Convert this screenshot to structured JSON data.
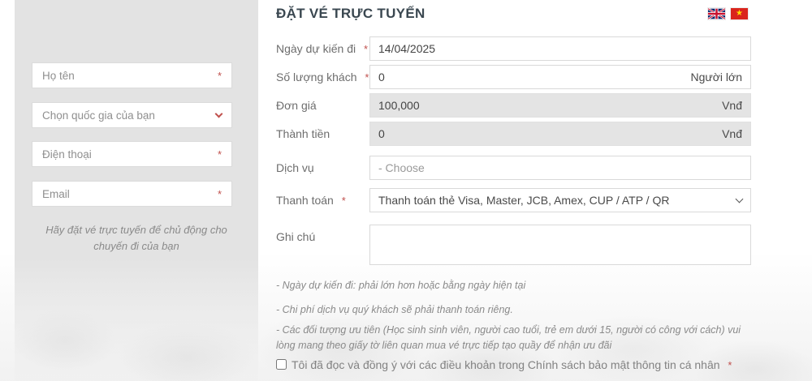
{
  "header": {
    "title": "ĐẶT VÉ TRỰC TUYẾN",
    "flags": [
      {
        "name": "english-flag"
      },
      {
        "name": "vietnam-flag",
        "star": "★"
      }
    ]
  },
  "required_mark": "*",
  "sidebar": {
    "fields": [
      {
        "placeholder": "Họ tên"
      },
      {
        "placeholder": "Chọn quốc gia của bạn"
      },
      {
        "placeholder": "Điện thoại"
      },
      {
        "placeholder": "Email"
      }
    ],
    "note": "Hãy đặt vé trực tuyến để chủ động cho chuyến đi của bạn"
  },
  "form": {
    "rows": [
      {
        "label": "Ngày dự kiến đi",
        "value": "14/04/2025"
      },
      {
        "label": "Số lượng khách",
        "value": "0",
        "suffix": "Người lớn"
      },
      {
        "label": "Đơn giá",
        "value": "100,000",
        "suffix": "Vnđ"
      },
      {
        "label": "Thành tiền",
        "value": "0",
        "suffix": "Vnđ"
      },
      {
        "label": "Dịch vụ",
        "placeholder": "- Choose"
      },
      {
        "label": "Thanh toán",
        "value": "Thanh toán thẻ Visa, Master, JCB, Amex, CUP / ATP / QR"
      },
      {
        "label": "Ghi chú",
        "value": ""
      }
    ],
    "notes": [
      "- Ngày dự kiến đi: phải lớn hơn hoặc bằng ngày hiện tại",
      "- Chi phí dịch vụ quý khách sẽ phải thanh toán riêng.",
      "- Các đối tượng ưu tiên (Học sinh sinh viên, người cao tuổi, trẻ em dưới 15, người có công với cách) vui lòng mang theo giấy tờ liên quan mua vé trực tiếp tạo quầy để nhận ưu đãi"
    ],
    "agreement": "Tôi đã đọc và đồng ý với các điều khoản trong Chính sách bảo mật thông tin cá nhân"
  },
  "colors": {
    "accent_red": "#c0504d",
    "title": "#3a4750",
    "panel_bg": "#e3e3e3",
    "disabled_bg": "#e4e4e4",
    "border": "#d9d9d9"
  }
}
